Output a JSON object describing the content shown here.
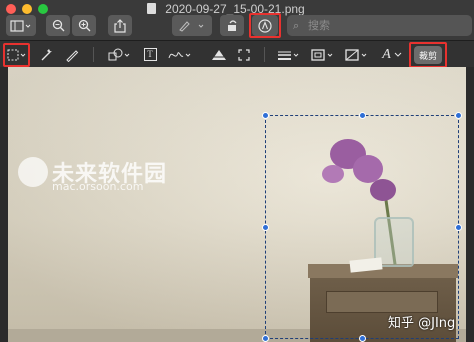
{
  "window": {
    "title": "2020-09-27_15-00-21.png"
  },
  "search": {
    "placeholder": "搜索"
  },
  "markup_toolbar": {
    "crop_label": "裁剪",
    "text_tool_glyph": "T",
    "signature_glyph": "A"
  },
  "colors": {
    "highlight": "#e8322f",
    "selection_handle": "#2f6fd6",
    "crop_button": "#6c6c6c"
  },
  "canvas": {
    "watermark": {
      "chinese": "未来软件园",
      "url": "mac.orsoon.com"
    },
    "credit": "知乎 @JIng"
  },
  "icons": [
    "sidebar-icon",
    "zoom-out-icon",
    "zoom-in-icon",
    "share-icon",
    "pen-icon",
    "rotate-icon",
    "markup-icon",
    "search-icon",
    "rect-select-icon",
    "magic-wand-icon",
    "sketch-icon",
    "shapes-icon",
    "text-icon",
    "sign-icon",
    "adjust-color-icon",
    "resize-icon",
    "line-style-icon",
    "border-color-icon",
    "fill-color-icon",
    "font-icon"
  ]
}
